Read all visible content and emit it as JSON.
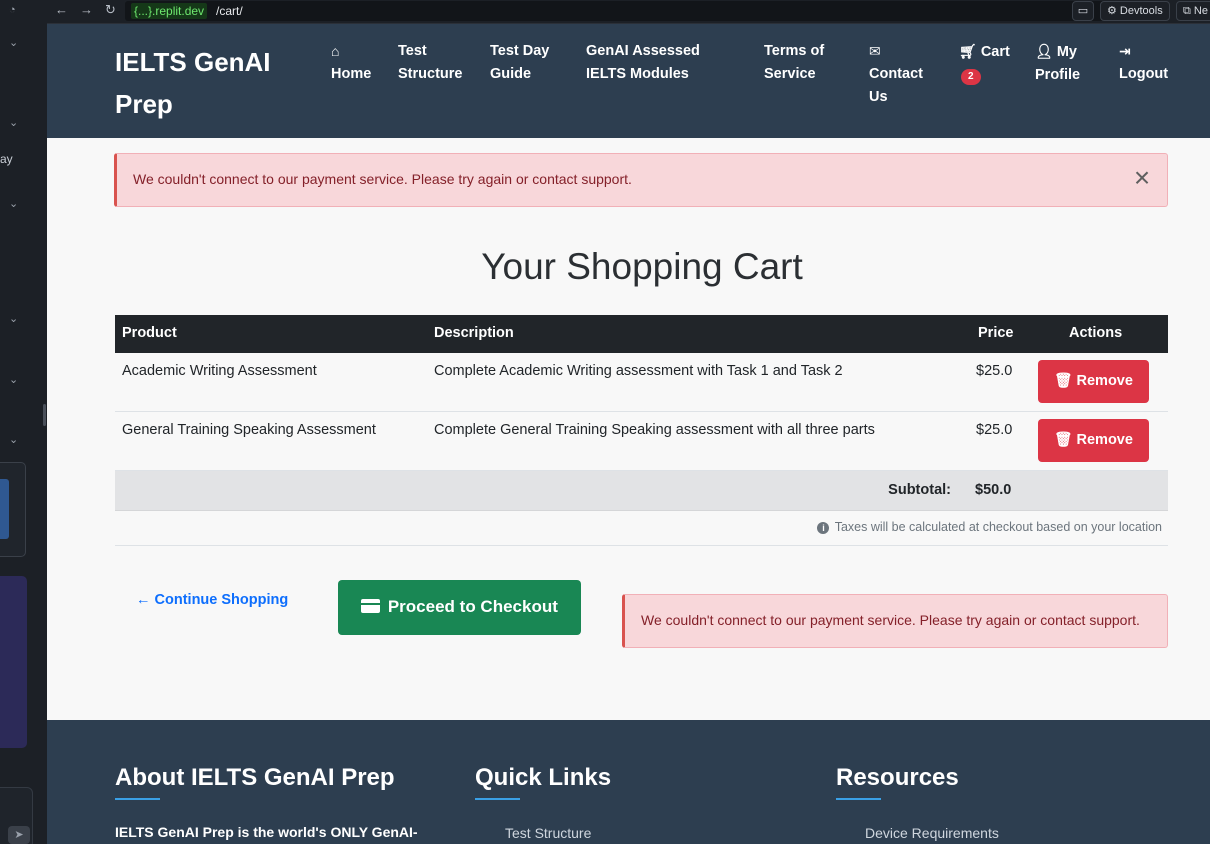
{
  "browser": {
    "url_host": "{...}.replit.dev",
    "url_path": "/cart/",
    "devtools_label": "Devtools",
    "new_tab_label": "Ne"
  },
  "ide": {
    "side_text": "ay"
  },
  "navbar": {
    "brand": "IELTS GenAI Prep",
    "items": [
      {
        "icon": "home-icon",
        "label": "Home"
      },
      {
        "label": "Test Structure"
      },
      {
        "label": "Test Day Guide"
      },
      {
        "label": "GenAI Assessed IELTS Modules"
      },
      {
        "label": "Terms of Service"
      },
      {
        "icon": "envelope-icon",
        "label": "Contact Us"
      },
      {
        "icon": "cart-icon",
        "label": "Cart",
        "badge": "2"
      },
      {
        "icon": "user-icon",
        "label": "My Profile"
      },
      {
        "icon": "logout-icon",
        "label": "Logout"
      }
    ]
  },
  "alerts": {
    "top": "We couldn't connect to our payment service. Please try again or contact support.",
    "bottom": "We couldn't connect to our payment service. Please try again or contact support."
  },
  "cart": {
    "title": "Your Shopping Cart",
    "columns": [
      "Product",
      "Description",
      "Price",
      "Actions"
    ],
    "rows": [
      {
        "product": "Academic Writing Assessment",
        "description": "Complete Academic Writing assessment with Task 1 and Task 2",
        "price": "$25.0",
        "action": "Remove"
      },
      {
        "product": "General Training Speaking Assessment",
        "description": "Complete General Training Speaking assessment with all three parts",
        "price": "$25.0",
        "action": "Remove"
      }
    ],
    "subtotal_label": "Subtotal:",
    "subtotal_value": "$50.0",
    "tax_note": "Taxes will be calculated at checkout based on your location",
    "continue_label": "Continue Shopping",
    "checkout_label": "Proceed to Checkout"
  },
  "footer": {
    "about_title": "About IELTS GenAI Prep",
    "about_text": "IELTS GenAI Prep is the world's ONLY GenAI-",
    "links_title": "Quick Links",
    "links_first": "Test Structure",
    "resources_title": "Resources",
    "resources_first": "Device Requirements"
  },
  "colors": {
    "navbar": "#2d3e50",
    "danger": "#dc3545",
    "success": "#198754",
    "link": "#0d6efd",
    "alert_bg": "#f8d7da"
  }
}
